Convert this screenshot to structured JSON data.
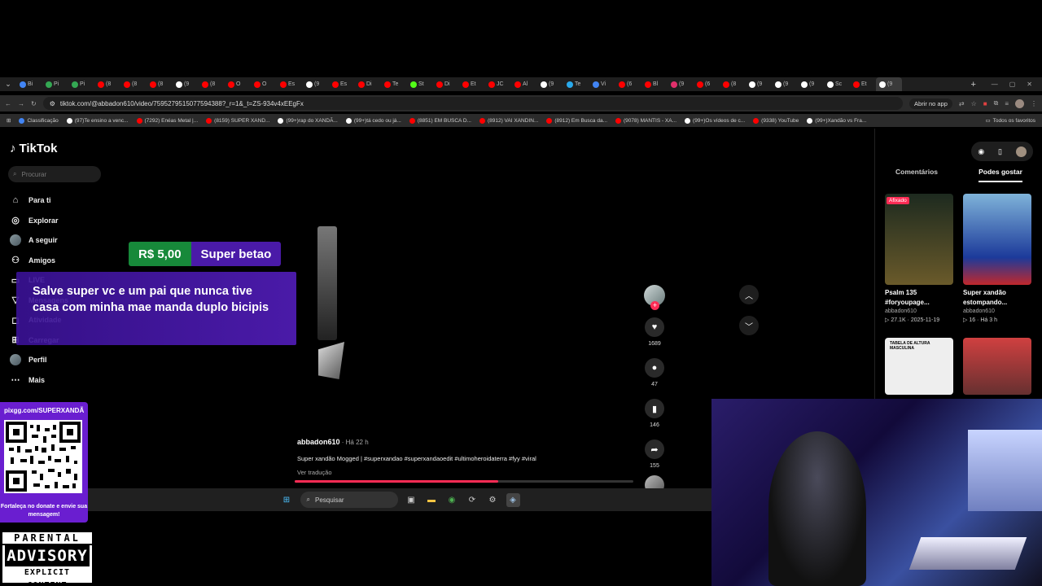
{
  "browser": {
    "tabs": [
      {
        "label": "Bi",
        "color": "#4285f4"
      },
      {
        "label": "Pi",
        "color": "#34a853"
      },
      {
        "label": "Pi",
        "color": "#34a853"
      },
      {
        "label": "(8",
        "color": "#ff0000"
      },
      {
        "label": "(8",
        "color": "#ff0000"
      },
      {
        "label": "(8",
        "color": "#ff0000"
      },
      {
        "label": "(9",
        "color": "#ffffff"
      },
      {
        "label": "(8",
        "color": "#ff0000"
      },
      {
        "label": "O",
        "color": "#ff0000"
      },
      {
        "label": "O",
        "color": "#ff0000"
      },
      {
        "label": "Es",
        "color": "#ff0000"
      },
      {
        "label": "(9",
        "color": "#ffffff"
      },
      {
        "label": "Es",
        "color": "#ff0000"
      },
      {
        "label": "Di",
        "color": "#ff0000"
      },
      {
        "label": "Te",
        "color": "#ff0000"
      },
      {
        "label": "St",
        "color": "#53fc18"
      },
      {
        "label": "Di",
        "color": "#ff0000"
      },
      {
        "label": "Et",
        "color": "#ff0000"
      },
      {
        "label": "JC",
        "color": "#ff0000"
      },
      {
        "label": "Al",
        "color": "#ff0000"
      },
      {
        "label": "(9",
        "color": "#ffffff"
      },
      {
        "label": "Te",
        "color": "#29a9eb"
      },
      {
        "label": "Vi",
        "color": "#4285f4"
      },
      {
        "label": "(6",
        "color": "#ff0000"
      },
      {
        "label": "Bl",
        "color": "#ff0000"
      },
      {
        "label": "(9",
        "color": "#e1306c"
      },
      {
        "label": "(6",
        "color": "#ff0000"
      },
      {
        "label": "(8",
        "color": "#ff0000"
      },
      {
        "label": "(9",
        "color": "#ffffff"
      },
      {
        "label": "(9",
        "color": "#ffffff"
      },
      {
        "label": "(9",
        "color": "#ffffff"
      },
      {
        "label": "Sc",
        "color": "#ffffff"
      },
      {
        "label": "Et",
        "color": "#ff0000"
      },
      {
        "label": "(9",
        "color": "#ffffff"
      }
    ],
    "url": "tiktok.com/@abbadon610/video/7595279515077594388?_r=1&_t=ZS-934v4xEEgFx",
    "open_in_app": "Abrir no app",
    "bookmarks": [
      {
        "label": "Classificação",
        "color": "#4285f4"
      },
      {
        "label": "(97)Te ensino a venc...",
        "color": "#ffffff"
      },
      {
        "label": "(7292) Enéas Metal |...",
        "color": "#ff0000"
      },
      {
        "label": "(8159) SUPER XAND...",
        "color": "#ff0000"
      },
      {
        "label": "(99+)rap do XANDÃ...",
        "color": "#ffffff"
      },
      {
        "label": "(99+)tá cedo ou já...",
        "color": "#ffffff"
      },
      {
        "label": "(8851) EM BUSCA D...",
        "color": "#ff0000"
      },
      {
        "label": "(8912) VAI XANDIN...",
        "color": "#ff0000"
      },
      {
        "label": "(8912) Em Busca da...",
        "color": "#ff0000"
      },
      {
        "label": "(9078) MANTIS - XA...",
        "color": "#ff0000"
      },
      {
        "label": "(99+)Os vídeos de c...",
        "color": "#ffffff"
      },
      {
        "label": "(9338) YouTube",
        "color": "#ff0000"
      },
      {
        "label": "(99+)Xandão vs Fra...",
        "color": "#ffffff"
      }
    ],
    "all_bookmarks": "Todos os favoritos"
  },
  "tiktok": {
    "logo": "TikTok",
    "search_placeholder": "Procurar",
    "nav": [
      {
        "label": "Para ti",
        "icon": "home-icon",
        "glyph": "⌂"
      },
      {
        "label": "Explorar",
        "icon": "compass-icon",
        "glyph": "◎"
      },
      {
        "label": "A seguir",
        "icon": "following-icon",
        "glyph": "●"
      },
      {
        "label": "Amigos",
        "icon": "friends-icon",
        "glyph": "⚇"
      },
      {
        "label": "LIVE",
        "icon": "live-icon",
        "glyph": "▭"
      },
      {
        "label": "Mensagens",
        "icon": "messages-icon",
        "glyph": "▽"
      },
      {
        "label": "Atividade",
        "icon": "activity-icon",
        "glyph": "◻"
      },
      {
        "label": "Carregar",
        "icon": "upload-icon",
        "glyph": "⊞"
      },
      {
        "label": "Perfil",
        "icon": "profile-icon",
        "glyph": "●"
      },
      {
        "label": "Mais",
        "icon": "more-icon",
        "glyph": "⋯"
      }
    ],
    "video": {
      "author": "abbadon610",
      "time": " · Há 22 h",
      "description": "Super xandão Mogged | #superxandao #superxandaoedit #ultimoheroidaterra #fyy #viral",
      "translate": "Ver tradução",
      "progress": 0.6
    },
    "actions": {
      "likes": "1689",
      "comments": "47",
      "saves": "146",
      "shares": "155"
    },
    "right_panel": {
      "tab_comments": "Comentários",
      "tab_may_like": "Podes gostar",
      "cards": [
        {
          "pinned": "Afixado",
          "title": "Psalm 135 #foryoupage...",
          "author": "abbadon610",
          "meta": "▷ 27.1K · 2025-11-19"
        },
        {
          "pinned": "",
          "title": "Super xandão estompando...",
          "author": "abbadon610",
          "meta": "▷ 16 · Há 3 h"
        },
        {
          "pinned": "",
          "title": "",
          "author": "",
          "meta": "",
          "thumb_text": "TABELA DE ALTURA MASCULINA"
        },
        {
          "pinned": "",
          "title": "",
          "author": "",
          "meta": ""
        }
      ]
    }
  },
  "overlay": {
    "donation_amount": "R$ 5,00",
    "donation_name": "Super betao",
    "donation_message": "Salve super vc e um pai que nunca tive casa com minha mae manda duplo bicipis",
    "qr_url": "pixgg.com/SUPERXANDÃ",
    "qr_caption": "Fortaleça no donate e envie sua mensagem!",
    "advisory_top": "PARENTAL",
    "advisory_mid": "ADVISORY",
    "advisory_bot": "EXPLICIT CONTENT"
  },
  "taskbar": {
    "search": "Pesquisar"
  }
}
